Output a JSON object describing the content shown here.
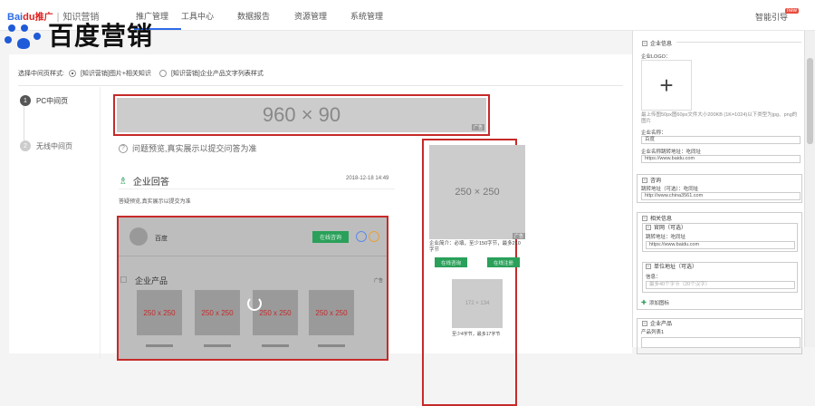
{
  "topbar": {
    "logo_bai": "Bai",
    "logo_du": "du",
    "logo_tuiguang": "推广",
    "logo_sep": "|",
    "logo_zhishi": "知识营销",
    "nav": [
      "推广管理",
      "工具中心",
      "数据报告",
      "资源管理",
      "系统管理"
    ],
    "smart_guide": "智能引导",
    "new_badge": "new"
  },
  "brand_overlay": {
    "text": "百度营销"
  },
  "style_select": {
    "label": "选择中间页样式:",
    "options": [
      "[知识营销]图片+相关知识",
      "[知识营销]企业产品文字列表样式"
    ]
  },
  "steps": [
    {
      "num": "1",
      "label": "PC中间页"
    },
    {
      "num": "2",
      "label": "无线中间页"
    }
  ],
  "banner": {
    "size_text": "960 × 90",
    "ad_tag": "广告"
  },
  "preview_tip": "问题预览,真实展示以提交问答为准",
  "qa": {
    "title": "企业回答",
    "date": "2018-12-18 14:49",
    "desc": "答疑预览,真实展示以提交为准"
  },
  "card": {
    "name": "百度",
    "online_btn": "在线咨询",
    "products_label": "企业产品",
    "ad": "广告",
    "tiles": [
      "250 x 250",
      "250 x 250",
      "250 x 250",
      "250 x 250"
    ]
  },
  "side": {
    "img_text": "250 × 250",
    "ad": "广告",
    "desc": "企业简介：必填，至少150字节，最多210字节",
    "btn1": "在线咨询",
    "btn2": "在线注册",
    "img2_text": "172 × 134",
    "desc2": "至少4字节，最多17字节"
  },
  "panel": {
    "sec_company": "企业信息",
    "logo_label": "企业LOGO：",
    "upload_hint": "最上传图50px图60px文件大小200KB (1K=1024)以下类型为jpg、png的图片",
    "name_label": "企业名称：",
    "name_value": "百度",
    "site_label": "企业名称跳转地址：吃同址",
    "site_value": "https://www.baidu.com",
    "sec_consult": "咨询",
    "jump_label": "跳转地址（可选）：吃同址",
    "jump_value": "http://www.china3561.com",
    "sec_related": "相关信息",
    "sub_official": "官网（可选）",
    "official_label": "跳转地址：吃同址",
    "official_value": "https://www.baidu.com",
    "sub_unit": "单位地址（可选）",
    "info_label": "信息：",
    "info_placeholder": "最多40个字节（20个汉字）",
    "add_icon": "添加图标",
    "sec_product": "企业产品",
    "product_list": "产品列表1"
  }
}
